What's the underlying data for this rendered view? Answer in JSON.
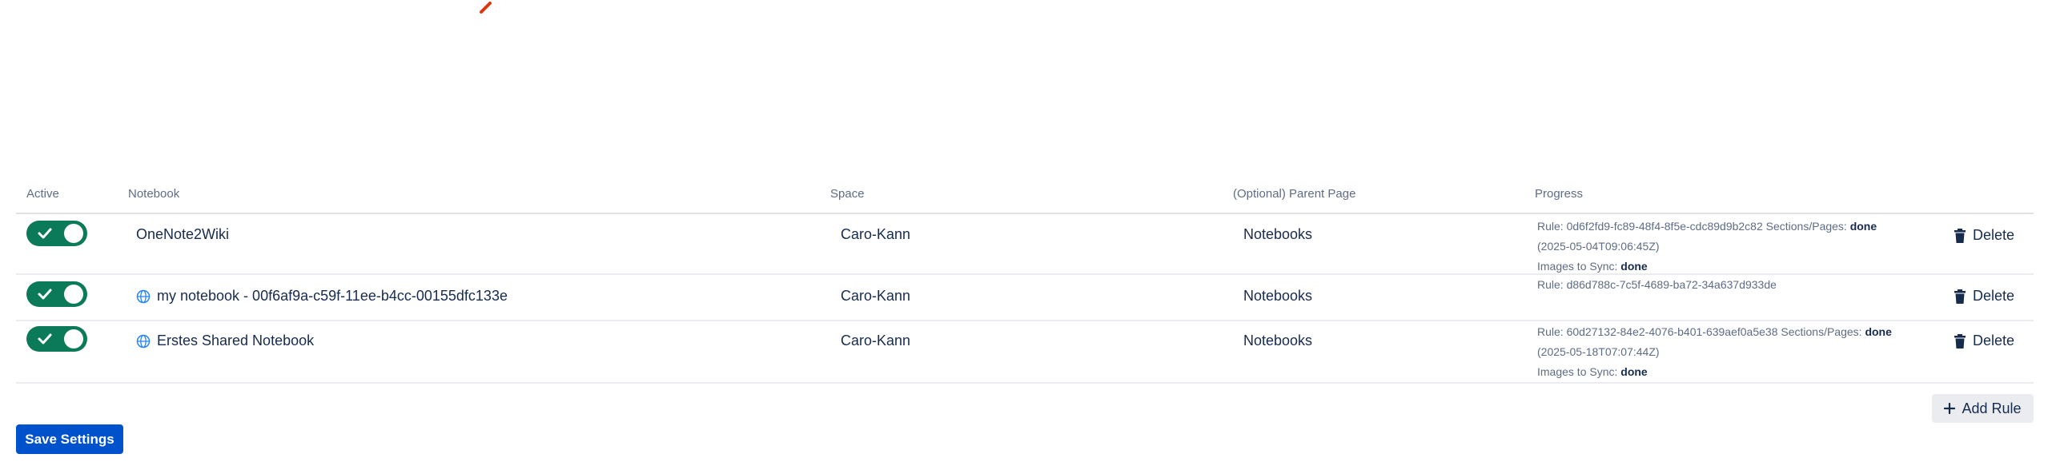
{
  "table": {
    "headers": {
      "active": "Active",
      "notebook": "Notebook",
      "space": "Space",
      "parent_page": "(Optional) Parent Page",
      "progress": "Progress"
    },
    "rows": [
      {
        "active": true,
        "notebook": "OneNote2Wiki",
        "notebook_icon": "",
        "space": "Caro-Kann",
        "parent_page": "Notebooks",
        "progress": {
          "line1_text": "Rule: 0d6f2fd9-fc89-48f4-8f5e-cdc89d9b2c82 Sections/Pages: ",
          "line1_status": "done",
          "line2": "(2025-05-04T09:06:45Z)",
          "line3_text": "Images to Sync: ",
          "line3_status": "done"
        },
        "delete_label": "Delete"
      },
      {
        "active": true,
        "notebook": "my notebook - 00f6af9a-c59f-11ee-b4cc-00155dfc133e",
        "notebook_icon": "globe-icon",
        "space": "Caro-Kann",
        "parent_page": "Notebooks",
        "progress": {
          "line1_text": "Rule: d86d788c-7c5f-4689-ba72-34a637d933de"
        },
        "delete_label": "Delete"
      },
      {
        "active": true,
        "notebook": "Erstes Shared Notebook",
        "notebook_icon": "globe-icon",
        "space": "Caro-Kann",
        "parent_page": "Notebooks",
        "progress": {
          "line1_text": "Rule: 60d27132-84e2-4076-b401-639aef0a5e38 Sections/Pages: ",
          "line1_status": "done",
          "line2": "(2025-05-18T07:07:44Z)",
          "line3_text": "Images to Sync: ",
          "line3_status": "done"
        },
        "delete_label": "Delete"
      }
    ]
  },
  "add_rule_label": "Add Rule",
  "save_label": "Save Settings",
  "colors": {
    "toggle_on": "#0a7a58",
    "primary_button": "#0052cc",
    "secondary_button": "#ebecf0",
    "header_text": "#5e6c84",
    "body_text": "#172b4d",
    "mark": "#de350b"
  }
}
